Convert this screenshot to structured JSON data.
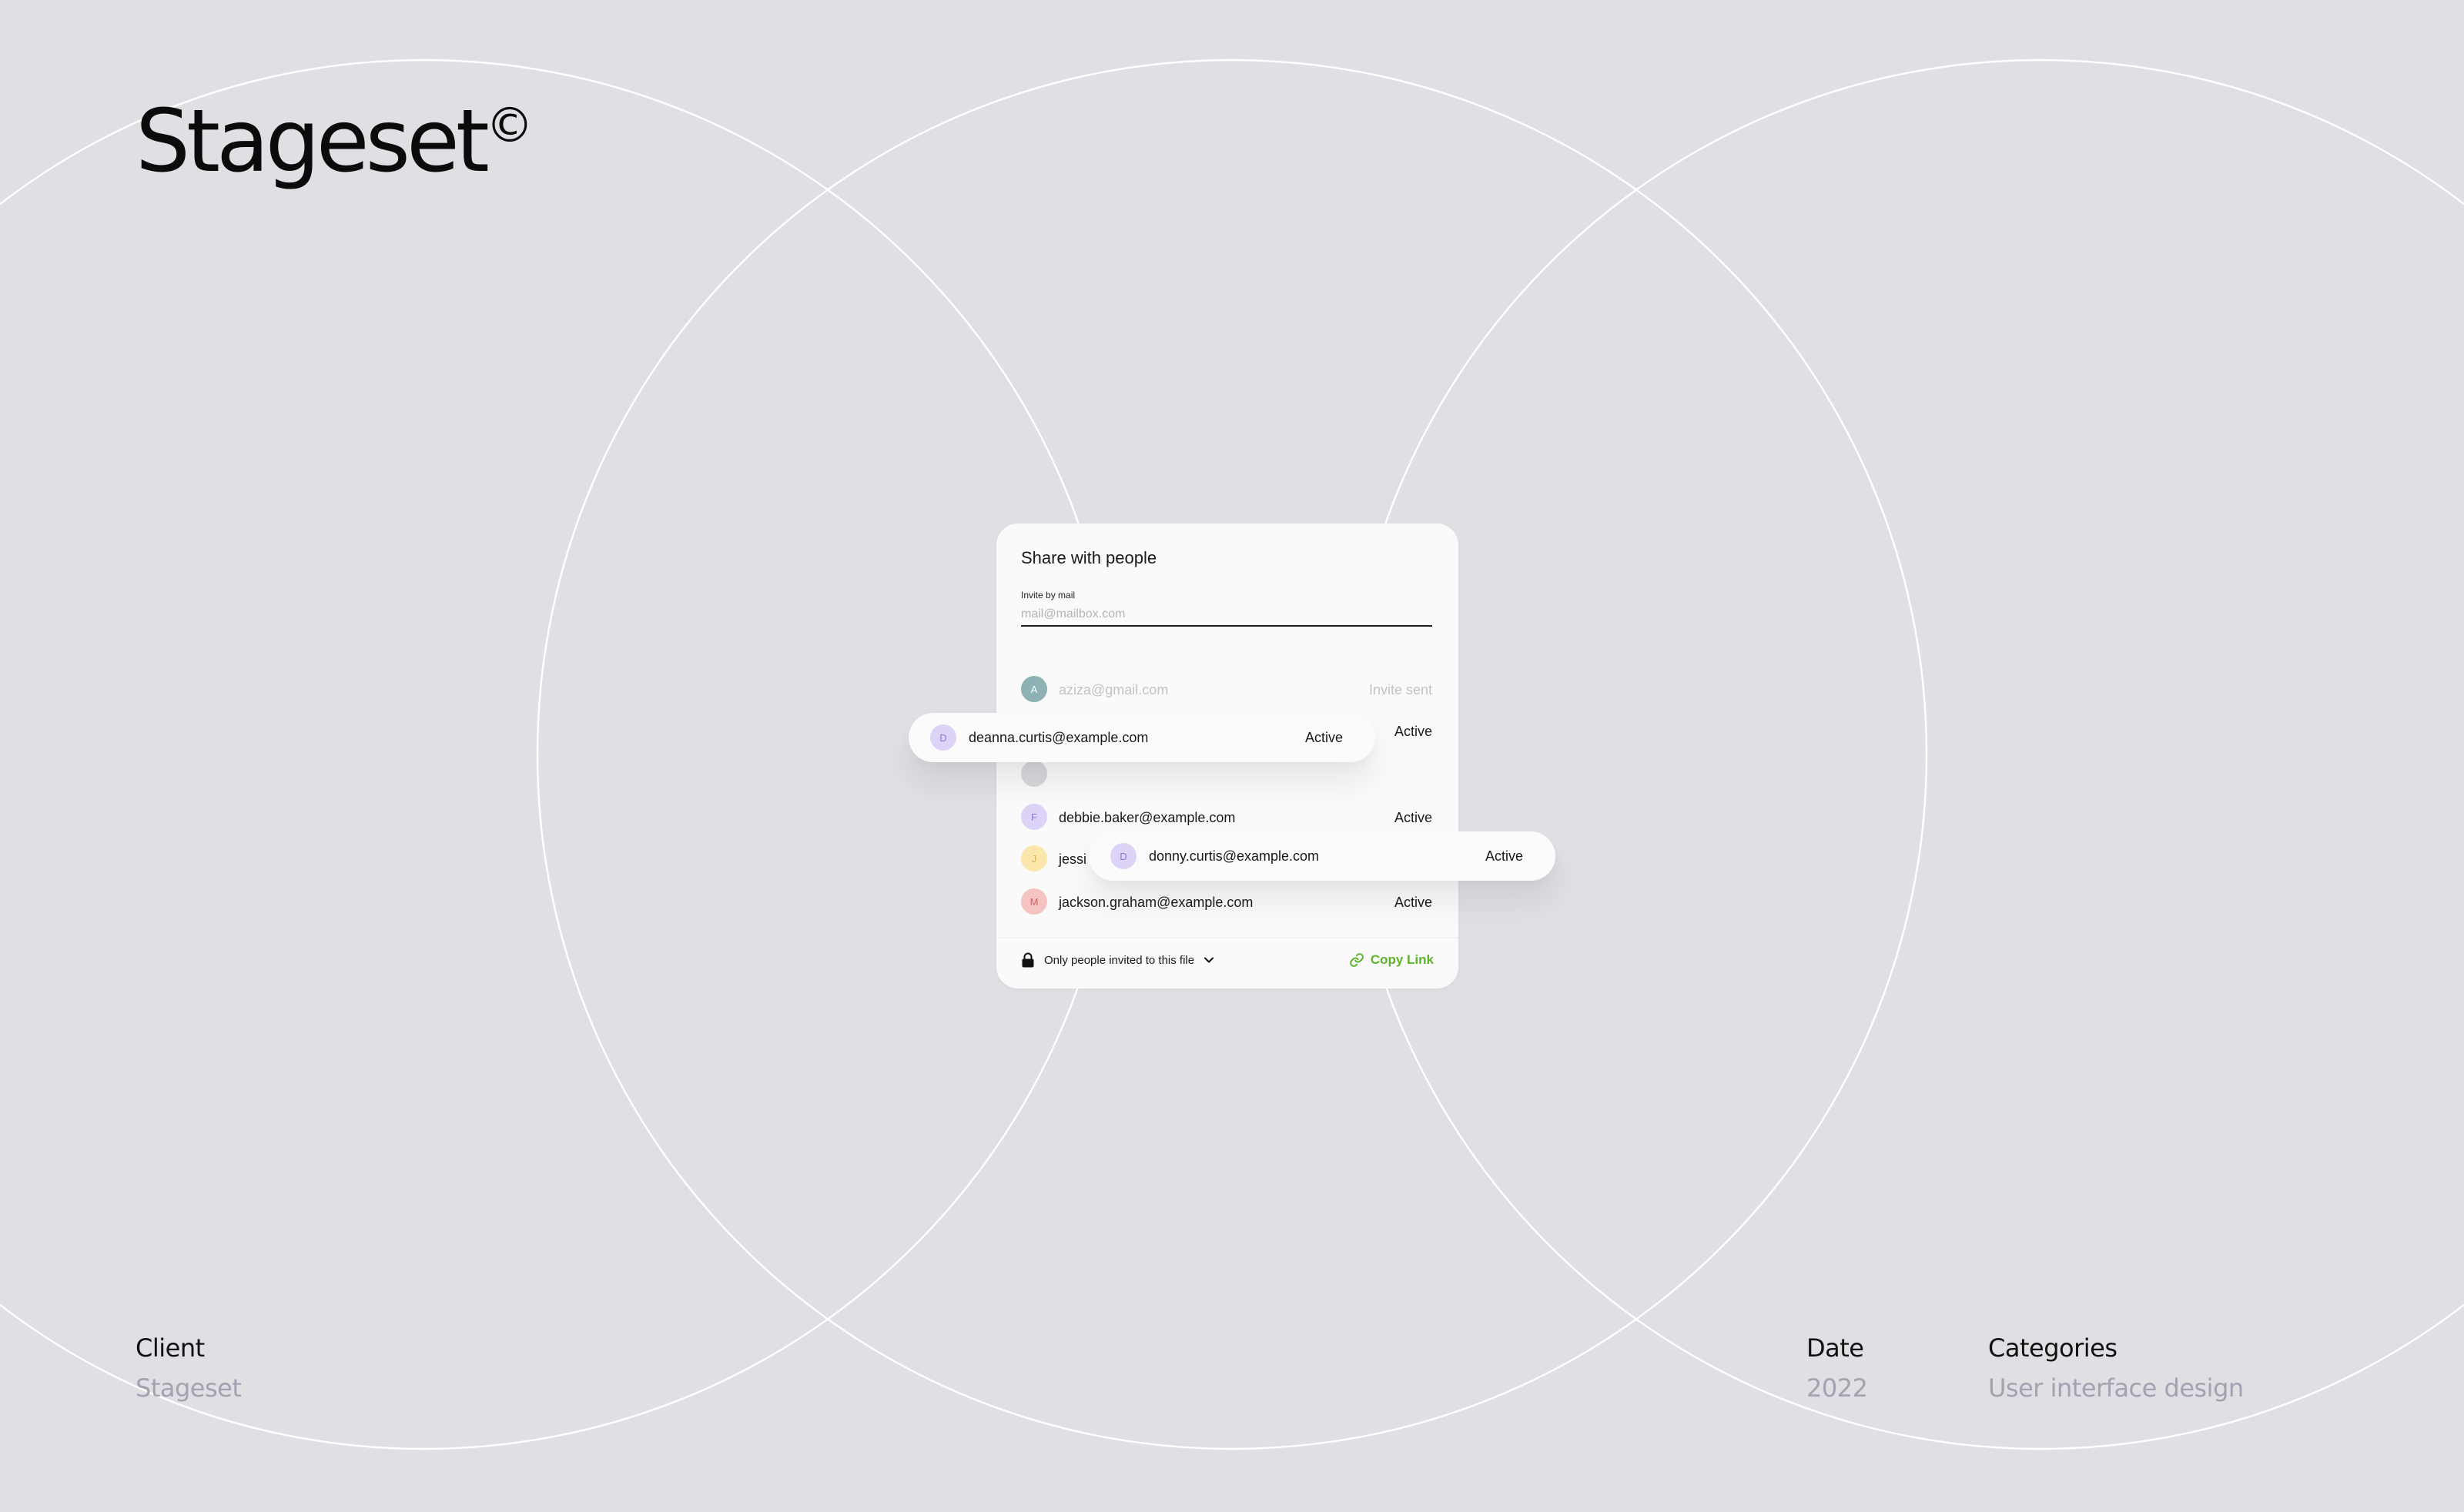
{
  "brand": {
    "name": "Stageset",
    "mark": "©"
  },
  "meta": {
    "client_label": "Client",
    "client_value": "Stageset",
    "date_label": "Date",
    "date_value": "2022",
    "categories_label": "Categories",
    "categories_value": "User interface design"
  },
  "dialog": {
    "title": "Share with people",
    "invite_label": "Invite by mail",
    "invite_placeholder": "mail@mailbox.com",
    "rows": [
      {
        "initial": "A",
        "email": "aziza@gmail.com",
        "status": "Invite sent",
        "avatar_bg": "#8eb1b4",
        "avatar_fg": "#ffffff"
      },
      {
        "initial": "",
        "email": "",
        "status": "Active",
        "avatar_bg": "#d8d8dc",
        "avatar_fg": "#ffffff"
      },
      {
        "initial": "",
        "email": "",
        "status": "",
        "avatar_bg": "#d8d8dc",
        "avatar_fg": "#ffffff"
      },
      {
        "initial": "F",
        "email": "debbie.baker@example.com",
        "status": "Active",
        "avatar_bg": "#dcd3f7",
        "avatar_fg": "#8d78d6"
      },
      {
        "initial": "J",
        "email": "jessi",
        "status": "",
        "avatar_bg": "#fbe7ac",
        "avatar_fg": "#d8b656"
      },
      {
        "initial": "M",
        "email": "jackson.graham@example.com",
        "status": "Active",
        "avatar_bg": "#f6c3c3",
        "avatar_fg": "#d16464"
      }
    ],
    "access_text": "Only people invited to this file",
    "copy_link": "Copy Link",
    "accent_color": "#5db52a"
  },
  "floating_rows": [
    {
      "initial": "D",
      "email": "deanna.curtis@example.com",
      "status": "Active",
      "avatar_bg": "#dcd3f7",
      "avatar_fg": "#8d78d6"
    },
    {
      "initial": "D",
      "email": "donny.curtis@example.com",
      "status": "Active",
      "avatar_bg": "#dcd3f7",
      "avatar_fg": "#8d78d6"
    }
  ],
  "icons": {
    "lock": "lock-icon",
    "chevron": "chevron-down-icon",
    "link": "link-icon"
  }
}
